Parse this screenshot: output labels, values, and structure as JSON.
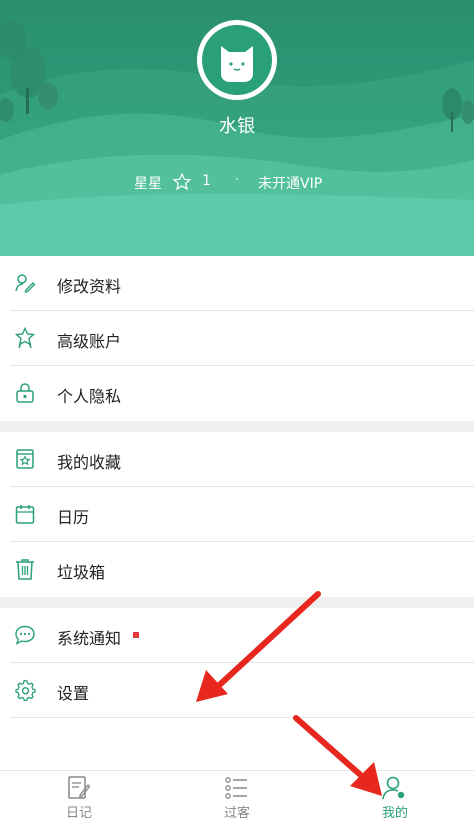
{
  "profile": {
    "username": "水银",
    "stars_label": "星星",
    "stars_count": "1",
    "separator": "·",
    "vip_status": "未开通VIP"
  },
  "menu": {
    "group1": [
      {
        "label": "修改资料",
        "icon": "edit-profile-icon"
      },
      {
        "label": "高级账户",
        "icon": "premium-account-icon"
      },
      {
        "label": "个人隐私",
        "icon": "privacy-lock-icon"
      }
    ],
    "group2": [
      {
        "label": "我的收藏",
        "icon": "favorites-icon"
      },
      {
        "label": "日历",
        "icon": "calendar-icon"
      },
      {
        "label": "垃圾箱",
        "icon": "trash-icon"
      }
    ],
    "group3": [
      {
        "label": "系统通知",
        "icon": "notification-icon"
      },
      {
        "label": "设置",
        "icon": "settings-gear-icon"
      }
    ]
  },
  "tabs": [
    {
      "label": "日记",
      "icon": "diary-icon",
      "active": false
    },
    {
      "label": "过客",
      "icon": "list-icon",
      "active": false
    },
    {
      "label": "我的",
      "icon": "profile-icon",
      "active": true
    }
  ],
  "colors": {
    "accent": "#2aa07a",
    "header": "#2f9c7a",
    "badge": "#e03a3a",
    "annotation_arrow": "#e8271f"
  }
}
